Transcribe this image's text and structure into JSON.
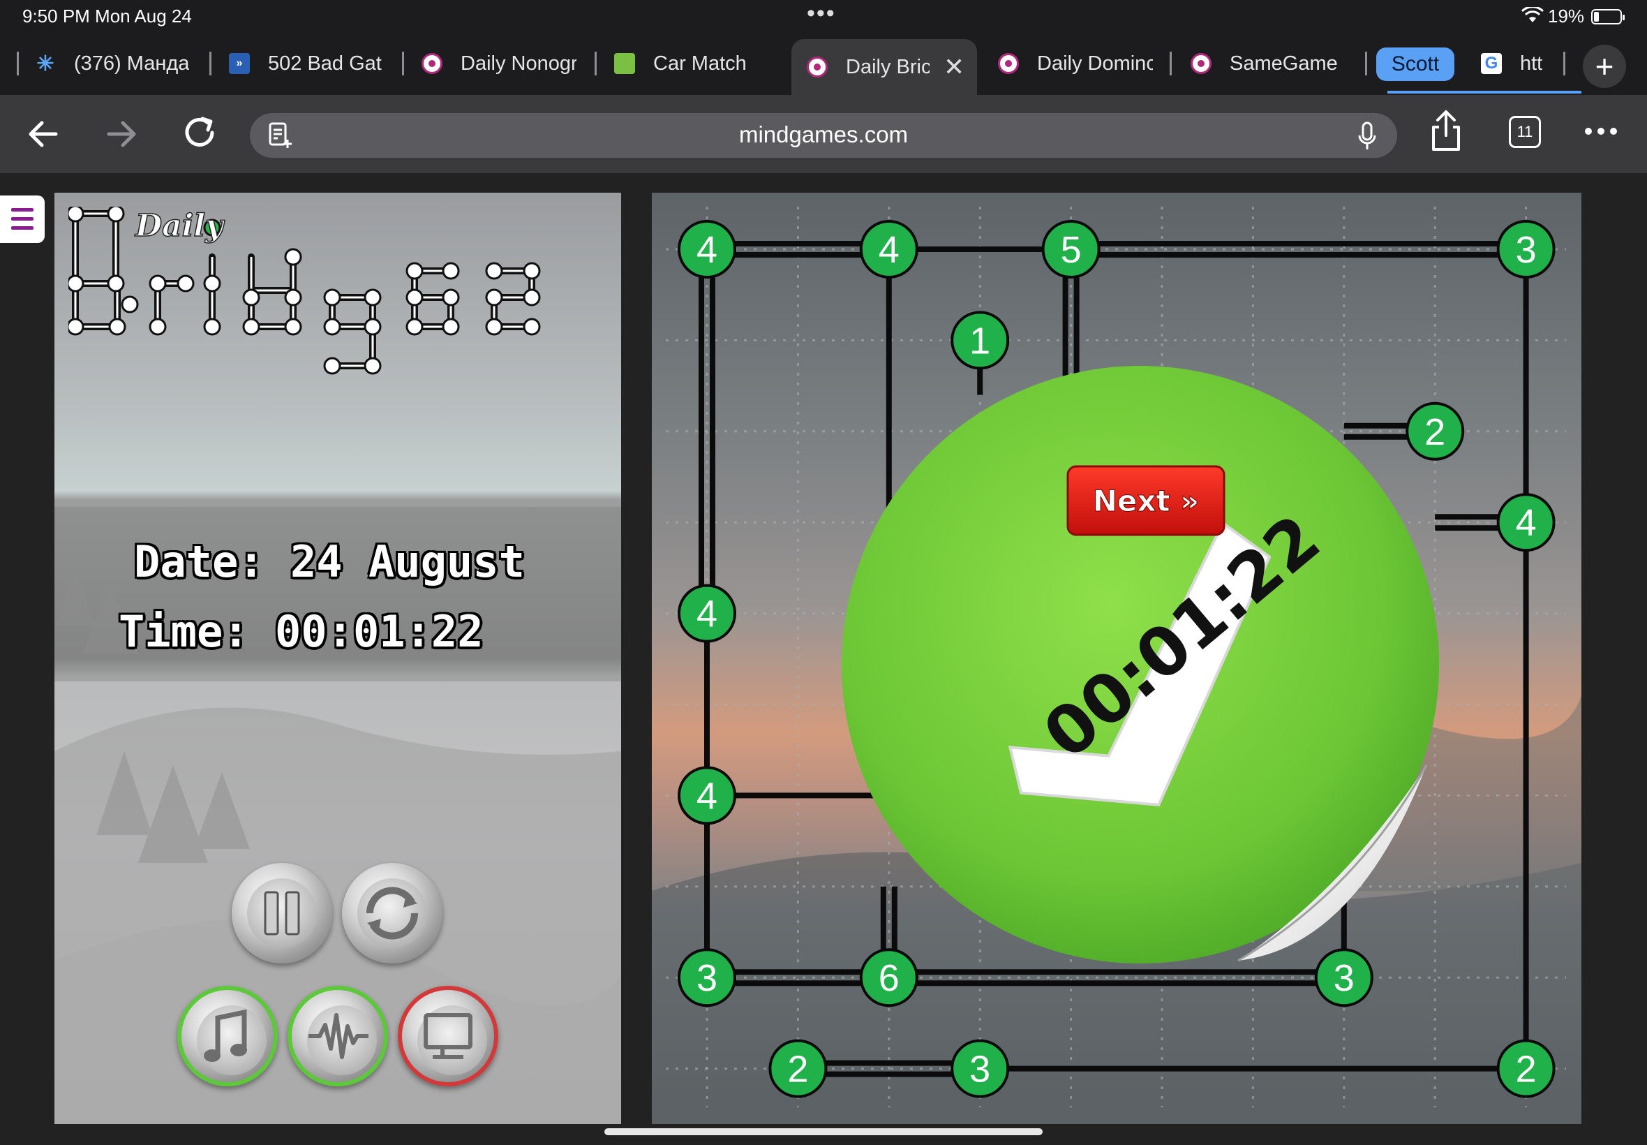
{
  "status": {
    "time": "9:50 PM   Mon Aug 24",
    "battery": "19%",
    "battery_level": 0.19
  },
  "tabs": [
    {
      "label": "(376) Манда",
      "icon": "spinner-icon"
    },
    {
      "label": "502 Bad Gat",
      "icon": "server-error-icon"
    },
    {
      "label": "Daily Nonogr",
      "icon": "mindgames-brain-icon"
    },
    {
      "label": "Car Match",
      "icon": "car-match-icon"
    },
    {
      "label": "Daily Bric",
      "icon": "mindgames-brain-icon",
      "active": true
    },
    {
      "label": "Daily Dominc",
      "icon": "mindgames-brain-icon"
    },
    {
      "label": "SameGame",
      "icon": "mindgames-brain-icon"
    },
    {
      "label": "htt",
      "icon": "google-icon"
    }
  ],
  "tab_group": "Scott",
  "address": {
    "url": "mindgames.com",
    "tab_count": "11"
  },
  "game": {
    "logo_word": "Daily",
    "date_text": "Date: 24 August",
    "time_text": "Time: 00:01:22",
    "completion_time": "00:01:22",
    "next_label": "Next »",
    "islands": [
      {
        "col": 0,
        "row": 0,
        "value": "4"
      },
      {
        "col": 2,
        "row": 0,
        "value": "4"
      },
      {
        "col": 4,
        "row": 0,
        "value": "5"
      },
      {
        "col": 9,
        "row": 0,
        "value": "3"
      },
      {
        "col": 3,
        "row": 1,
        "value": "1"
      },
      {
        "col": 8,
        "row": 2,
        "value": "2"
      },
      {
        "col": 9,
        "row": 3,
        "value": "4"
      },
      {
        "col": 0,
        "row": 4,
        "value": "4"
      },
      {
        "col": 0,
        "row": 6,
        "value": "4"
      },
      {
        "col": 0,
        "row": 8,
        "value": "3"
      },
      {
        "col": 2,
        "row": 8,
        "value": "6"
      },
      {
        "col": 7,
        "row": 8,
        "value": "3"
      },
      {
        "col": 1,
        "row": 9,
        "value": "2"
      },
      {
        "col": 3,
        "row": 9,
        "value": "3"
      },
      {
        "col": 9,
        "row": 9,
        "value": "2"
      }
    ],
    "bridges": [
      {
        "from": [
          0,
          0
        ],
        "to": [
          2,
          0
        ],
        "count": 2
      },
      {
        "from": [
          2,
          0
        ],
        "to": [
          4,
          0
        ],
        "count": 1
      },
      {
        "from": [
          4,
          0
        ],
        "to": [
          9,
          0
        ],
        "count": 2
      },
      {
        "from": [
          0,
          0
        ],
        "to": [
          0,
          4
        ],
        "count": 2
      },
      {
        "from": [
          0,
          4
        ],
        "to": [
          0,
          6
        ],
        "count": 1
      },
      {
        "from": [
          0,
          6
        ],
        "to": [
          0,
          8
        ],
        "count": 1
      },
      {
        "from": [
          2,
          0
        ],
        "to": [
          2,
          5
        ],
        "count": 1
      },
      {
        "from": [
          4,
          0
        ],
        "to": [
          4,
          1.4
        ],
        "count": 2
      },
      {
        "from": [
          3,
          1
        ],
        "to": [
          3,
          1.6
        ],
        "count": 1
      },
      {
        "from": [
          7,
          2
        ],
        "to": [
          8,
          2
        ],
        "count": 2
      },
      {
        "from": [
          8,
          3
        ],
        "to": [
          9,
          3
        ],
        "count": 2
      },
      {
        "from": [
          9,
          0
        ],
        "to": [
          9,
          9
        ],
        "count": 1
      },
      {
        "from": [
          0,
          6
        ],
        "to": [
          2,
          6
        ],
        "count": 1
      },
      {
        "from": [
          2,
          7
        ],
        "to": [
          2,
          8
        ],
        "count": 2
      },
      {
        "from": [
          0,
          8
        ],
        "to": [
          2,
          8
        ],
        "count": 2
      },
      {
        "from": [
          2,
          8
        ],
        "to": [
          7,
          8
        ],
        "count": 2
      },
      {
        "from": [
          7,
          7
        ],
        "to": [
          7,
          8
        ],
        "count": 1
      },
      {
        "from": [
          1,
          9
        ],
        "to": [
          3,
          9
        ],
        "count": 2
      },
      {
        "from": [
          3,
          9
        ],
        "to": [
          9,
          9
        ],
        "count": 1
      }
    ]
  },
  "controls": [
    {
      "name": "pause-button",
      "icon": "pause-icon",
      "ring": "none"
    },
    {
      "name": "restart-button",
      "icon": "restart-icon",
      "ring": "none"
    },
    {
      "name": "music-toggle-button",
      "icon": "music-note-icon",
      "ring": "green"
    },
    {
      "name": "sound-toggle-button",
      "icon": "sound-wave-icon",
      "ring": "green"
    },
    {
      "name": "fullscreen-toggle-button",
      "icon": "monitor-icon",
      "ring": "red"
    }
  ]
}
